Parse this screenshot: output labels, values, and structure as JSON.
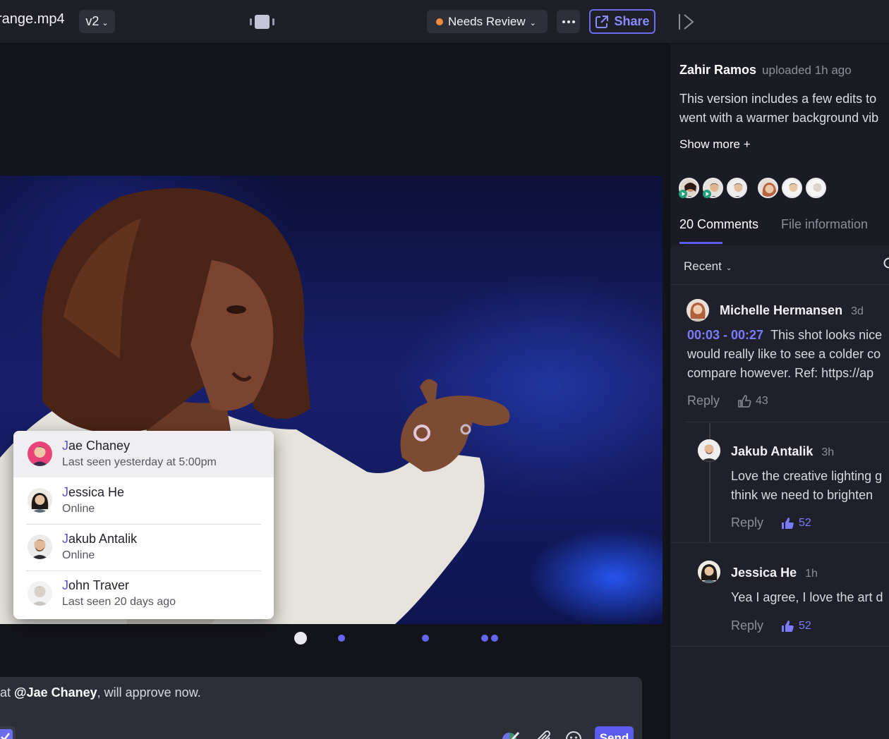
{
  "toolbar": {
    "filename": "range.mp4",
    "version": "v2",
    "status": "Needs Review",
    "status_color": "#f08a3c",
    "share_label": "Share",
    "accent_color": "#5b5bef"
  },
  "timeline_markers": [
    "comment-marker",
    "comment-marker",
    "comment-marker",
    "comment-marker"
  ],
  "composer": {
    "prefix": "at ",
    "mention": "@Jae Chaney",
    "suffix": ", will approve now.",
    "send_label": "Send",
    "tools": [
      "annotate-icon",
      "attachment-icon",
      "emoji-icon"
    ]
  },
  "mention_popup": {
    "people": [
      {
        "initial": "J",
        "rest": "ae Chaney",
        "status": "Last seen yesterday at 5:00pm"
      },
      {
        "initial": "J",
        "rest": "essica He",
        "status": "Online"
      },
      {
        "initial": "J",
        "rest": "akub Antalik",
        "status": "Online"
      },
      {
        "initial": "J",
        "rest": "ohn Traver",
        "status": "Last seen 20 days ago"
      }
    ]
  },
  "panel": {
    "uploader": "Zahir Ramos",
    "uploaded": "uploaded 1h ago",
    "description_lines": [
      "This version includes a few edits to",
      "went with a warmer background vib"
    ],
    "show_more": "Show more +",
    "tabs": [
      "20 Comments",
      "File information"
    ],
    "sort_label": "Recent"
  },
  "comments": [
    {
      "author": "Michelle Hermansen",
      "time": "3d",
      "timestamp": "00:03 - 00:27",
      "lines": [
        "This shot looks nice",
        "would really like to see a colder co",
        "compare however. Ref: https://ap"
      ],
      "reply": "Reply",
      "likes": "43"
    },
    {
      "author": "Jakub Antalik",
      "time": "3h",
      "lines": [
        "Love the creative lighting g",
        "think we need to brighten"
      ],
      "reply": "Reply",
      "likes": "52"
    },
    {
      "author": "Jessica He",
      "time": "1h",
      "lines": [
        "Yea I agree, I love the art d"
      ],
      "reply": "Reply",
      "likes": "52"
    }
  ]
}
